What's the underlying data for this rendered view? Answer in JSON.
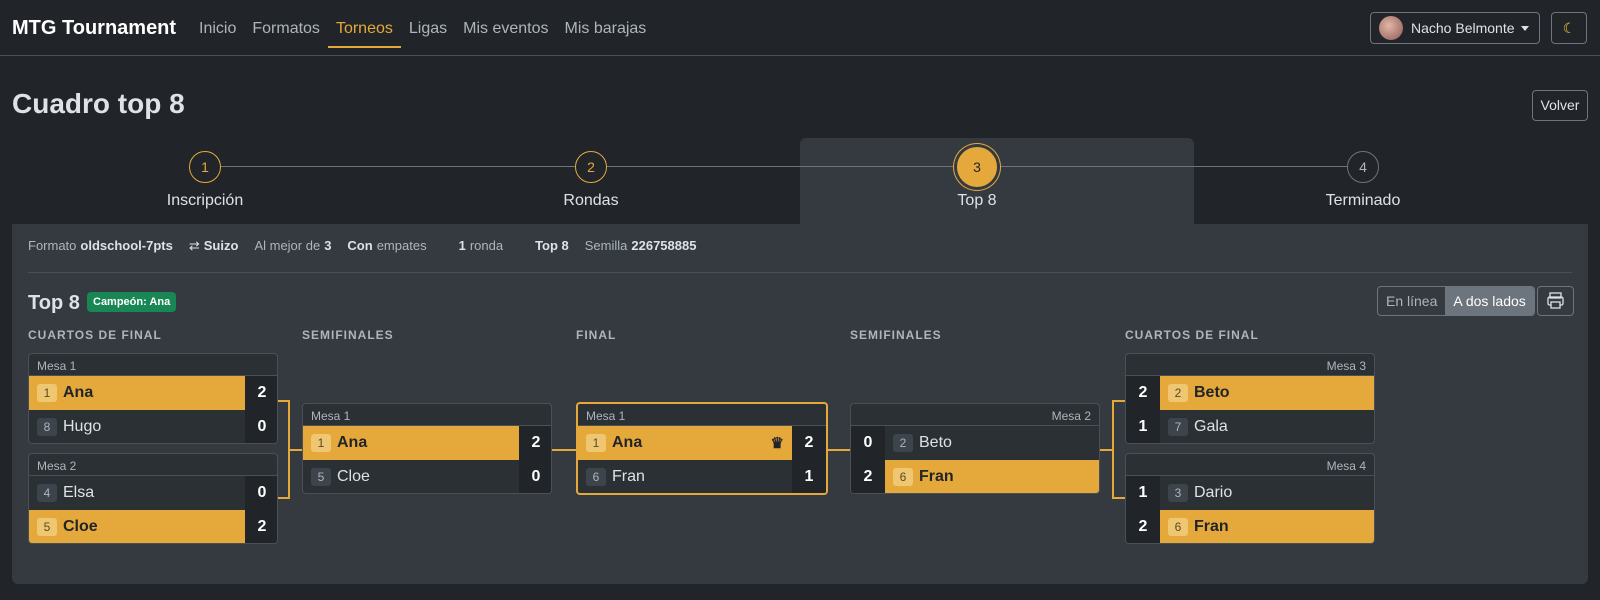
{
  "nav": {
    "brand": "MTG Tournament",
    "links": [
      "Inicio",
      "Formatos",
      "Torneos",
      "Ligas",
      "Mis eventos",
      "Mis barajas"
    ],
    "active": "Torneos",
    "user": "Nacho Belmonte",
    "theme_icon": "moon-icon"
  },
  "page": {
    "title": "Cuadro top 8",
    "back": "Volver"
  },
  "steps": [
    {
      "num": "1",
      "label": "Inscripción"
    },
    {
      "num": "2",
      "label": "Rondas"
    },
    {
      "num": "3",
      "label": "Top 8"
    },
    {
      "num": "4",
      "label": "Terminado"
    }
  ],
  "meta": {
    "format_label": "Formato",
    "format": "oldschool-7pts",
    "system": "Suizo",
    "bestof_label": "Al mejor de",
    "bestof": "3",
    "draws_bold": "Con",
    "draws": "empates",
    "rounds_num": "1",
    "rounds": "ronda",
    "top": "Top 8",
    "seed_label": "Semilla",
    "seed": "226758885"
  },
  "bracket": {
    "title": "Top 8",
    "champion": "Campeón: Ana",
    "view_inline": "En línea",
    "view_two_sides": "A dos lados",
    "headers": {
      "qf": "CUARTOS DE FINAL",
      "sf": "SEMIFINALES",
      "f": "FINAL"
    },
    "matches": {
      "qf1": {
        "table": "Mesa 1",
        "p1": {
          "seed": "1",
          "name": "Ana",
          "score": "2"
        },
        "p2": {
          "seed": "8",
          "name": "Hugo",
          "score": "0"
        }
      },
      "qf2": {
        "table": "Mesa 2",
        "p1": {
          "seed": "4",
          "name": "Elsa",
          "score": "0"
        },
        "p2": {
          "seed": "5",
          "name": "Cloe",
          "score": "2"
        }
      },
      "sf1": {
        "table": "Mesa 1",
        "p1": {
          "seed": "1",
          "name": "Ana",
          "score": "2"
        },
        "p2": {
          "seed": "5",
          "name": "Cloe",
          "score": "0"
        }
      },
      "final": {
        "table": "Mesa 1",
        "p1": {
          "seed": "1",
          "name": "Ana",
          "score": "2"
        },
        "p2": {
          "seed": "6",
          "name": "Fran",
          "score": "1"
        }
      },
      "sf2": {
        "table": "Mesa 2",
        "p1": {
          "seed": "2",
          "name": "Beto",
          "score": "0"
        },
        "p2": {
          "seed": "6",
          "name": "Fran",
          "score": "2"
        }
      },
      "qf3": {
        "table": "Mesa 3",
        "p1": {
          "seed": "2",
          "name": "Beto",
          "score": "2"
        },
        "p2": {
          "seed": "7",
          "name": "Gala",
          "score": "1"
        }
      },
      "qf4": {
        "table": "Mesa 4",
        "p1": {
          "seed": "3",
          "name": "Dario",
          "score": "1"
        },
        "p2": {
          "seed": "6",
          "name": "Fran",
          "score": "2"
        }
      }
    }
  },
  "colors": {
    "accent": "#e5a93b",
    "success": "#198754",
    "bg": "#212529",
    "card": "#343a40"
  }
}
